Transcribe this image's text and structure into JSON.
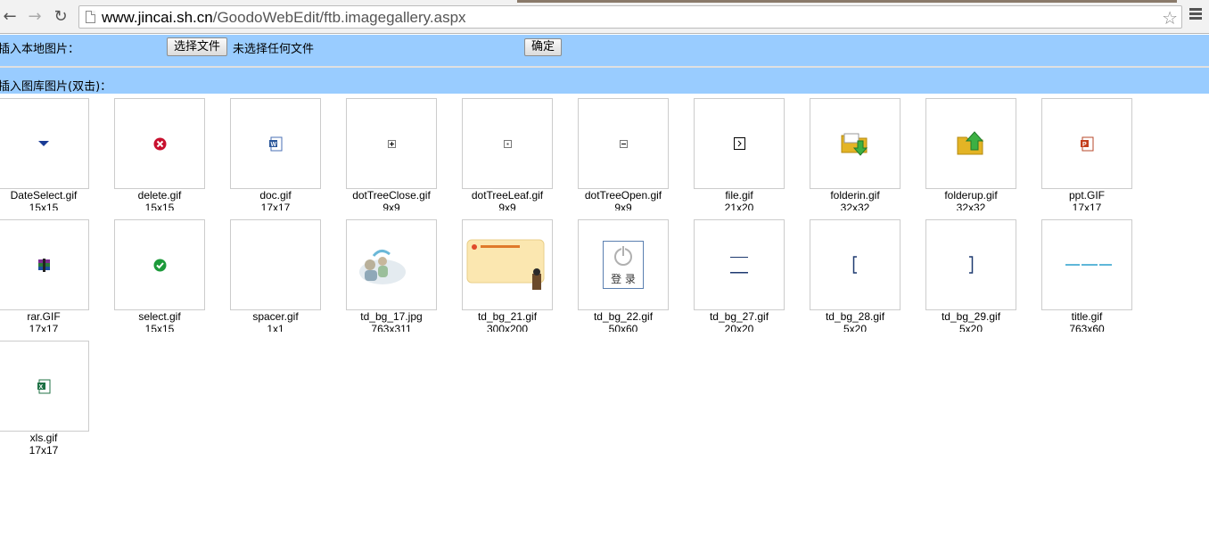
{
  "browser": {
    "url_host": "www.jincai.sh.cn",
    "url_path": "/GoodoWebEdit/ftb.imagegallery.aspx"
  },
  "upload": {
    "label": "插入本地图片：",
    "choose_button": "选择文件",
    "status": "未选择任何文件",
    "confirm_button": "确定"
  },
  "gallery": {
    "label": "插入图库图片(双击)：",
    "items": [
      {
        "name": "DateSelect.gif",
        "size": "15x15",
        "icon": "down-arrow-icon"
      },
      {
        "name": "delete.gif",
        "size": "15x15",
        "icon": "delete-icon"
      },
      {
        "name": "doc.gif",
        "size": "17x17",
        "icon": "word-doc-icon"
      },
      {
        "name": "dotTreeClose.gif",
        "size": "9x9",
        "icon": "tree-plus-icon"
      },
      {
        "name": "dotTreeLeaf.gif",
        "size": "9x9",
        "icon": "tree-leaf-icon"
      },
      {
        "name": "dotTreeOpen.gif",
        "size": "9x9",
        "icon": "tree-minus-icon"
      },
      {
        "name": "file.gif",
        "size": "21x20",
        "icon": "file-icon"
      },
      {
        "name": "folderin.gif",
        "size": "32x32",
        "icon": "folder-in-icon"
      },
      {
        "name": "folderup.gif",
        "size": "32x32",
        "icon": "folder-up-icon"
      },
      {
        "name": "ppt.GIF",
        "size": "17x17",
        "icon": "ppt-icon"
      },
      {
        "name": "rar.GIF",
        "size": "17x17",
        "icon": "rar-icon"
      },
      {
        "name": "select.gif",
        "size": "15x15",
        "icon": "checkmark-icon"
      },
      {
        "name": "spacer.gif",
        "size": "1x1",
        "icon": "blank-icon"
      },
      {
        "name": "td_bg_17.jpg",
        "size": "763x311",
        "icon": "people-image-icon"
      },
      {
        "name": "td_bg_21.gif",
        "size": "300x200",
        "icon": "notice-card-icon"
      },
      {
        "name": "td_bg_22.gif",
        "size": "50x60",
        "icon": "power-login-icon",
        "caption": "登 录"
      },
      {
        "name": "td_bg_27.gif",
        "size": "20x20",
        "icon": "line-bar-icon"
      },
      {
        "name": "td_bg_28.gif",
        "size": "5x20",
        "icon": "left-bracket-icon"
      },
      {
        "name": "td_bg_29.gif",
        "size": "5x20",
        "icon": "right-bracket-icon"
      },
      {
        "name": "title.gif",
        "size": "763x60",
        "icon": "title-banner-icon"
      },
      {
        "name": "xls.gif",
        "size": "17x17",
        "icon": "excel-icon"
      }
    ]
  },
  "colors": {
    "band": "#99ccff",
    "thumb_border": "#cccccc"
  }
}
